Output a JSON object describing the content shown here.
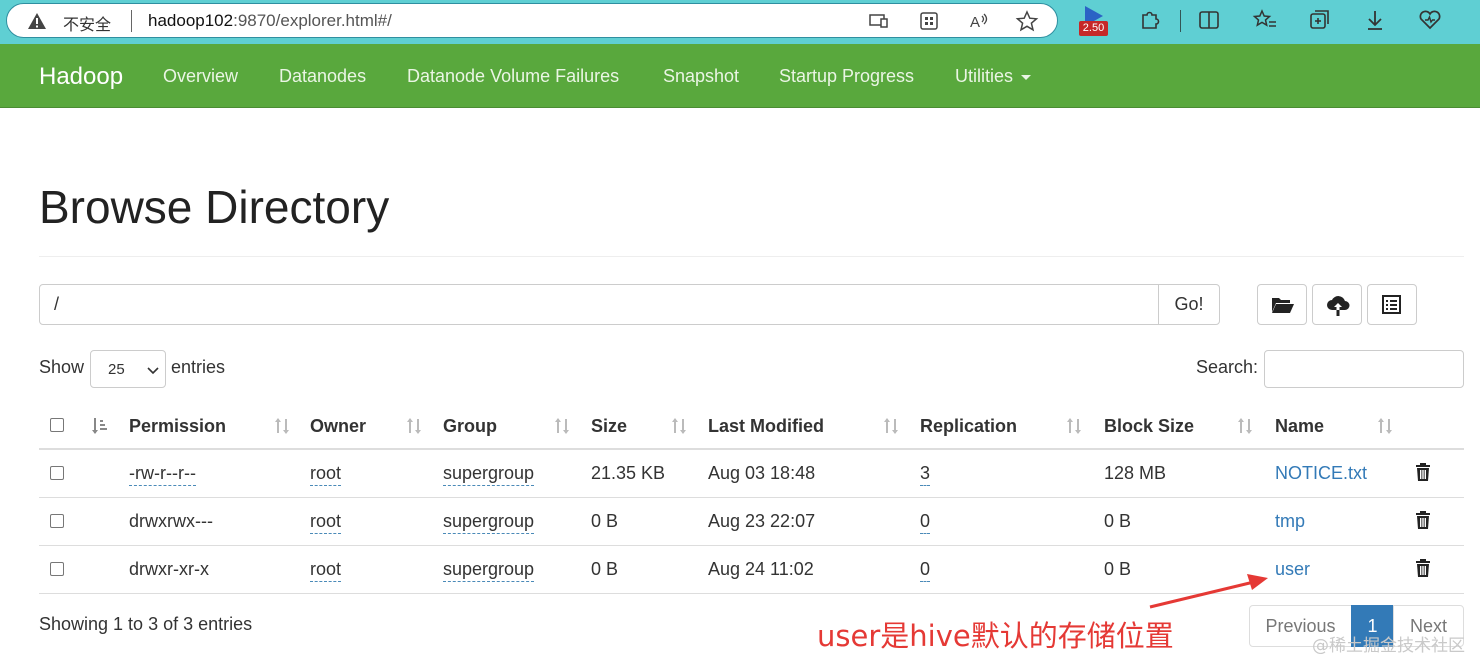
{
  "browser": {
    "security_label": "不安全",
    "url_host": "hadoop102",
    "url_rest": ":9870/explorer.html#/",
    "extension_badge": "2.50"
  },
  "navbar": {
    "brand": "Hadoop",
    "items": [
      "Overview",
      "Datanodes",
      "Datanode Volume Failures",
      "Snapshot",
      "Startup Progress",
      "Utilities"
    ],
    "accent_color": "#59a83d"
  },
  "page": {
    "title": "Browse Directory",
    "path_value": "/",
    "go_label": "Go!",
    "show_label": "Show",
    "entries_value": "25",
    "entries_label": "entries",
    "search_label": "Search:",
    "search_value": ""
  },
  "table": {
    "columns": [
      "Permission",
      "Owner",
      "Group",
      "Size",
      "Last Modified",
      "Replication",
      "Block Size",
      "Name"
    ],
    "rows": [
      {
        "permission": "-rw-r--r--",
        "owner": "root",
        "group": "supergroup",
        "size": "21.35 KB",
        "modified": "Aug 03 18:48",
        "replication": "3",
        "block_size": "128 MB",
        "name": "NOTICE.txt"
      },
      {
        "permission": "drwxrwx---",
        "owner": "root",
        "group": "supergroup",
        "size": "0 B",
        "modified": "Aug 23 22:07",
        "replication": "0",
        "block_size": "0 B",
        "name": "tmp"
      },
      {
        "permission": "drwxr-xr-x",
        "owner": "root",
        "group": "supergroup",
        "size": "0 B",
        "modified": "Aug 24 11:02",
        "replication": "0",
        "block_size": "0 B",
        "name": "user"
      }
    ]
  },
  "footer": {
    "info": "Showing 1 to 3 of 3 entries",
    "previous": "Previous",
    "current_page": "1",
    "next": "Next"
  },
  "annotation": {
    "text": "user是hive默认的存储位置",
    "color": "#e53935"
  },
  "watermark": "@稀土掘金技术社区"
}
